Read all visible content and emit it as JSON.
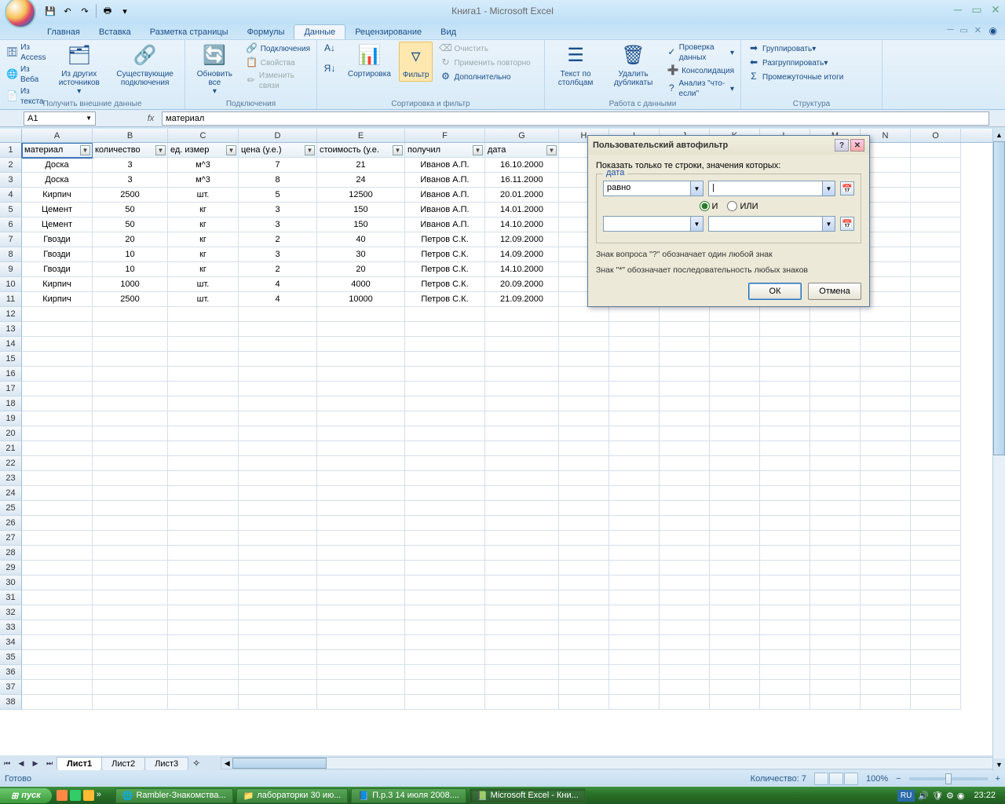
{
  "title": "Книга1 - Microsoft Excel",
  "qat": {
    "save": "💾",
    "undo": "↶",
    "redo": "↷",
    "print": "🖶"
  },
  "tabs": {
    "home": "Главная",
    "insert": "Вставка",
    "layout": "Разметка страницы",
    "formulas": "Формулы",
    "data": "Данные",
    "review": "Рецензирование",
    "view": "Вид"
  },
  "ribbon": {
    "ext": {
      "access": "Из Access",
      "web": "Из Веба",
      "text": "Из текста",
      "other": "Из других источников",
      "existing": "Существующие подключения",
      "label": "Получить внешние данные"
    },
    "conn": {
      "refresh": "Обновить все",
      "connections": "Подключения",
      "properties": "Свойства",
      "editlinks": "Изменить связи",
      "label": "Подключения"
    },
    "sort": {
      "az": "А↓Я",
      "za": "Я↓А",
      "sort": "Сортировка",
      "filter": "Фильтр",
      "clear": "Очистить",
      "reapply": "Применить повторно",
      "advanced": "Дополнительно",
      "label": "Сортировка и фильтр"
    },
    "tools": {
      "t2c": "Текст по столбцам",
      "dup": "Удалить дубликаты",
      "valid": "Проверка данных",
      "consol": "Консолидация",
      "whatif": "Анализ \"что-если\"",
      "label": "Работа с данными"
    },
    "outline": {
      "group": "Группировать",
      "ungroup": "Разгруппировать",
      "subtotal": "Промежуточные итоги",
      "label": "Структура"
    }
  },
  "namebox": "A1",
  "formula": "материал",
  "columns": [
    "A",
    "B",
    "C",
    "D",
    "E",
    "F",
    "G",
    "H",
    "I",
    "J",
    "K",
    "L",
    "M",
    "N",
    "O"
  ],
  "headers": [
    "материал",
    "количество",
    "ед. измер",
    "цена (у.е.)",
    "стоимость (у.е.",
    "получил",
    "дата"
  ],
  "rows": [
    [
      "Доска",
      "3",
      "м^3",
      "7",
      "21",
      "Иванов А.П.",
      "16.10.2000"
    ],
    [
      "Доска",
      "3",
      "м^3",
      "8",
      "24",
      "Иванов А.П.",
      "16.11.2000"
    ],
    [
      "Кирпич",
      "2500",
      "шт.",
      "5",
      "12500",
      "Иванов А.П.",
      "20.01.2000"
    ],
    [
      "Цемент",
      "50",
      "кг",
      "3",
      "150",
      "Иванов А.П.",
      "14.01.2000"
    ],
    [
      "Цемент",
      "50",
      "кг",
      "3",
      "150",
      "Иванов А.П.",
      "14.10.2000"
    ],
    [
      "Гвозди",
      "20",
      "кг",
      "2",
      "40",
      "Петров С.К.",
      "12.09.2000"
    ],
    [
      "Гвозди",
      "10",
      "кг",
      "3",
      "30",
      "Петров С.К.",
      "14.09.2000"
    ],
    [
      "Гвозди",
      "10",
      "кг",
      "2",
      "20",
      "Петров С.К.",
      "14.10.2000"
    ],
    [
      "Кирпич",
      "1000",
      "шт.",
      "4",
      "4000",
      "Петров С.К.",
      "20.09.2000"
    ],
    [
      "Кирпич",
      "2500",
      "шт.",
      "4",
      "10000",
      "Петров С.К.",
      "21.09.2000"
    ]
  ],
  "sheets": {
    "s1": "Лист1",
    "s2": "Лист2",
    "s3": "Лист3"
  },
  "status": {
    "ready": "Готово",
    "count": "Количество: 7",
    "zoom": "100%"
  },
  "dialog": {
    "title": "Пользовательский автофильтр",
    "prompt": "Показать только те строки, значения которых:",
    "legend": "дата",
    "op1": "равно",
    "and": "И",
    "or": "ИЛИ",
    "hint1": "Знак вопроса \"?\" обозначает один любой знак",
    "hint2": "Знак \"*\" обозначает последовательность любых знаков",
    "ok": "ОК",
    "cancel": "Отмена"
  },
  "taskbar": {
    "start": "пуск",
    "t1": "Rambler-Знакомства...",
    "t2": "лабораторки 30 ию...",
    "t3": "П.р.3 14 июля 2008....",
    "t4": "Microsoft Excel - Кни...",
    "lang": "RU",
    "time": "23:22"
  }
}
